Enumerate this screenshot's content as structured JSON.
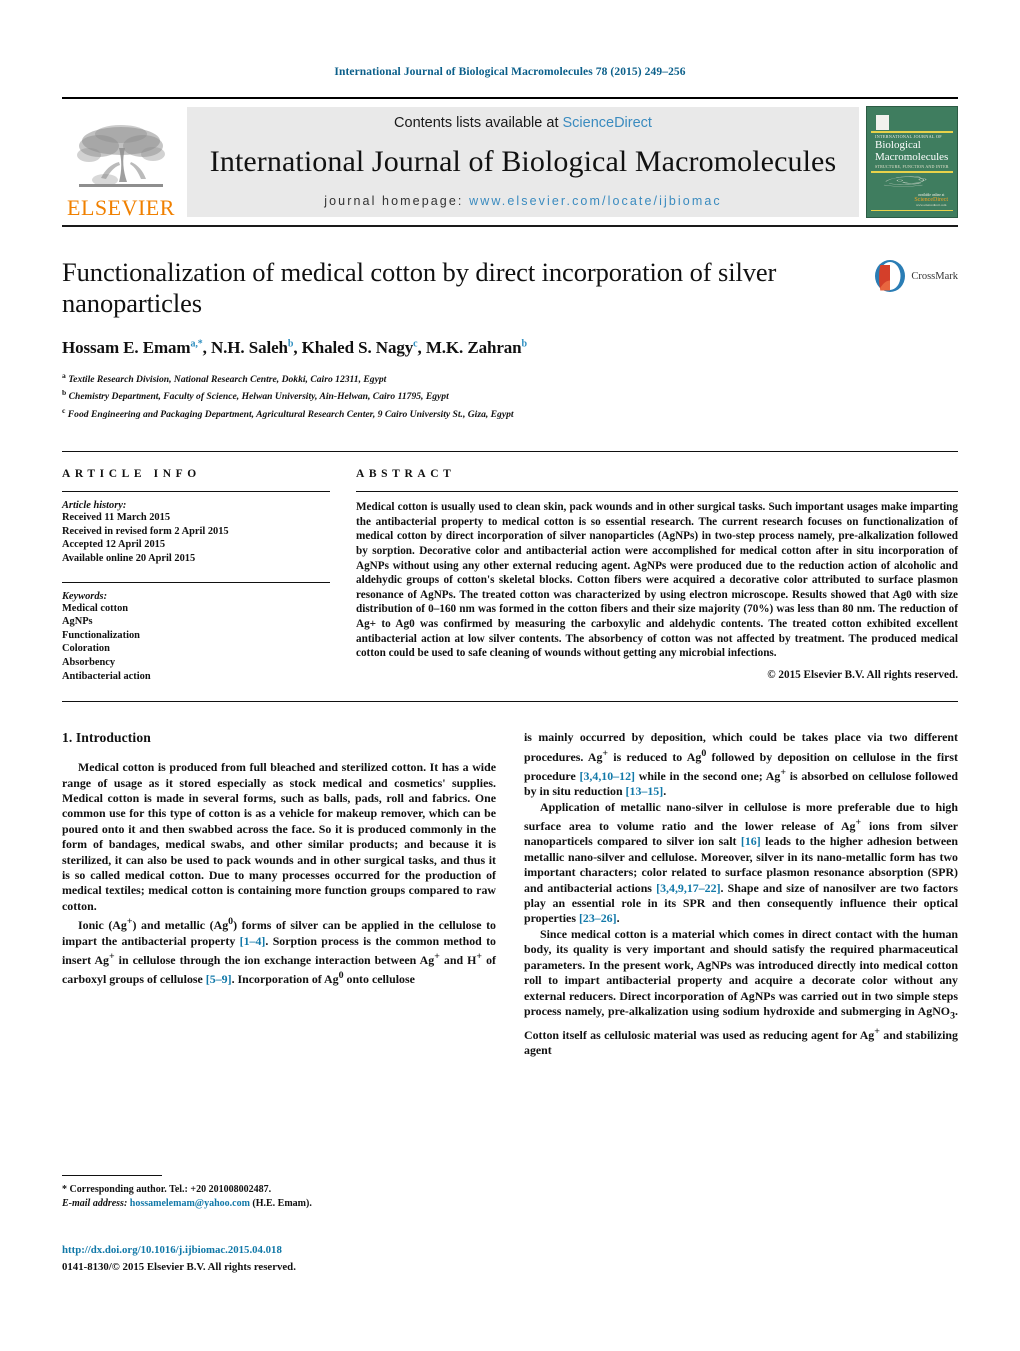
{
  "running_head": "International Journal of Biological Macromolecules 78 (2015) 249–256",
  "masthead": {
    "publisher_logo_text": "ELSEVIER",
    "contents_prefix": "Contents lists available at ",
    "contents_link": "ScienceDirect",
    "journal_title": "International Journal of Biological Macromolecules",
    "homepage_prefix": "journal homepage: ",
    "homepage_url": "www.elsevier.com/locate/ijbiomac",
    "cover": {
      "eyebrow": "INTERNATIONAL JOURNAL OF",
      "title_line1": "Biological",
      "title_line2": "Macromolecules",
      "subtitle": "STRUCTURE, FUNCTION AND INTERACTIONS",
      "available_at": "available online at",
      "sd_mark": "ScienceDirect",
      "sd_url": "www.sciencedirect.com"
    }
  },
  "article": {
    "title": "Functionalization of medical cotton by direct incorporation of silver nanoparticles",
    "crossmark_label": "CrossMark",
    "authors_html": "Hossam E. Emam<sup class=\"star\">a,*</sup>, N.H. Saleh<sup>b</sup>, Khaled S. Nagy<sup>c</sup>, M.K. Zahran<sup>b</sup>",
    "affiliations": [
      {
        "marker": "a",
        "text": "Textile Research Division, National Research Centre, Dokki, Cairo 12311, Egypt"
      },
      {
        "marker": "b",
        "text": "Chemistry Department, Faculty of Science, Helwan University, Ain-Helwan, Cairo 11795, Egypt"
      },
      {
        "marker": "c",
        "text": "Food Engineering and Packaging Department, Agricultural Research Center, 9 Cairo University St., Giza, Egypt"
      }
    ]
  },
  "article_info": {
    "heading": "ARTICLE INFO",
    "history_label": "Article history:",
    "history": [
      "Received 11 March 2015",
      "Received in revised form 2 April 2015",
      "Accepted 12 April 2015",
      "Available online 20 April 2015"
    ],
    "keywords_label": "Keywords:",
    "keywords": [
      "Medical cotton",
      "AgNPs",
      "Functionalization",
      "Coloration",
      "Absorbency",
      "Antibacterial action"
    ]
  },
  "abstract": {
    "heading": "ABSTRACT",
    "text": "Medical cotton is usually used to clean skin, pack wounds and in other surgical tasks. Such important usages make imparting the antibacterial property to medical cotton is so essential research. The current research focuses on functionalization of medical cotton by direct incorporation of silver nanoparticles (AgNPs) in two-step process namely, pre-alkalization followed by sorption. Decorative color and antibacterial action were accomplished for medical cotton after in situ incorporation of AgNPs without using any other external reducing agent. AgNPs were produced due to the reduction action of alcoholic and aldehydic groups of cotton's skeletal blocks. Cotton fibers were acquired a decorative color attributed to surface plasmon resonance of AgNPs. The treated cotton was characterized by using electron microscope. Results showed that Ag0 with size distribution of 0–160 nm was formed in the cotton fibers and their size majority (70%) was less than 80 nm. The reduction of Ag+ to Ag0 was confirmed by measuring the carboxylic and aldehydic contents. The treated cotton exhibited excellent antibacterial action at low silver contents. The absorbency of cotton was not affected by treatment. The produced medical cotton could be used to safe cleaning of wounds without getting any microbial infections.",
    "copyright": "© 2015 Elsevier B.V. All rights reserved."
  },
  "body": {
    "section_number_title": "1.  Introduction",
    "left_paragraphs": [
      "Medical cotton is produced from full bleached and sterilized cotton. It has a wide range of usage as it stored especially as stock medical and cosmetics' supplies. Medical cotton is made in several forms, such as balls, pads, roll and fabrics. One common use for this type of cotton is as a vehicle for makeup remover, which can be poured onto it and then swabbed across the face. So it is produced commonly in the form of bandages, medical swabs, and other similar products; and because it is sterilized, it can also be used to pack wounds and in other surgical tasks, and thus it is so called medical cotton. Due to many processes occurred for the production of medical textiles; medical cotton is containing more function groups compared to raw cotton."
    ],
    "left_para2_html": "Ionic (Ag<sup>+</sup>) and metallic (Ag<sup>0</sup>) forms of silver can be applied in the cellulose to impart the antibacterial property <span class=\"ref\">[1–4]</span>. Sorption process is the common method to insert Ag<sup>+</sup> in cellulose through the ion exchange interaction between Ag<sup>+</sup> and H<sup>+</sup> of carboxyl groups of cellulose <span class=\"ref\">[5–9]</span>. Incorporation of Ag<sup>0</sup> onto cellulose",
    "right_para1_html": "is mainly occurred by deposition, which could be takes place via two different procedures. Ag<sup>+</sup> is reduced to Ag<sup>0</sup> followed by deposition on cellulose in the first procedure <span class=\"ref\">[3,4,10–12]</span> while in the second one; Ag<sup>+</sup> is absorbed on cellulose followed by in situ reduction <span class=\"ref\">[13–15]</span>.",
    "right_para2_html": "Application of metallic nano-silver in cellulose is more preferable due to high surface area to volume ratio and the lower release of Ag<sup>+</sup> ions from silver nanoparticels compared to silver ion salt <span class=\"ref\">[16]</span> leads to the higher adhesion between metallic nano-silver and cellulose. Moreover, silver in its nano-metallic form has two important characters; color related to surface plasmon resonance absorption (SPR) and antibacterial actions <span class=\"ref\">[3,4,9,17–22]</span>. Shape and size of nanosilver are two factors play an essential role in its SPR and then consequently influence their optical properties <span class=\"ref\">[23–26]</span>.",
    "right_para3_html": "Since medical cotton is a material which comes in direct contact with the human body, its quality is very important and should satisfy the required pharmaceutical parameters. In the present work, AgNPs was introduced directly into medical cotton roll to impart antibacterial property and acquire a decorate color without any external reducers. Direct incorporation of AgNPs was carried out in two simple steps process namely, pre-alkalization using sodium hydroxide and submerging in AgNO<sub>3</sub>. Cotton itself as cellulosic material was used as reducing agent for Ag<sup>+</sup> and stabilizing agent"
  },
  "footer": {
    "corresponding_html": "* Corresponding author. Tel.: +20 201008002487.",
    "email_label": "E-mail address:",
    "email": "hossamelemam@yahoo.com",
    "email_suffix": " (H.E. Emam).",
    "doi_url": "http://dx.doi.org/10.1016/j.ijbiomac.2015.04.018",
    "issn_line": "0141-8130/© 2015 Elsevier B.V. All rights reserved."
  },
  "colors": {
    "link_blue": "#1178a8",
    "header_blue": "#0b5f8a",
    "elsevier_orange": "#f08000",
    "cover_green": "#3f7d5f",
    "crossmark_red": "#d43f2a",
    "crossmark_blue": "#2a7db5"
  }
}
